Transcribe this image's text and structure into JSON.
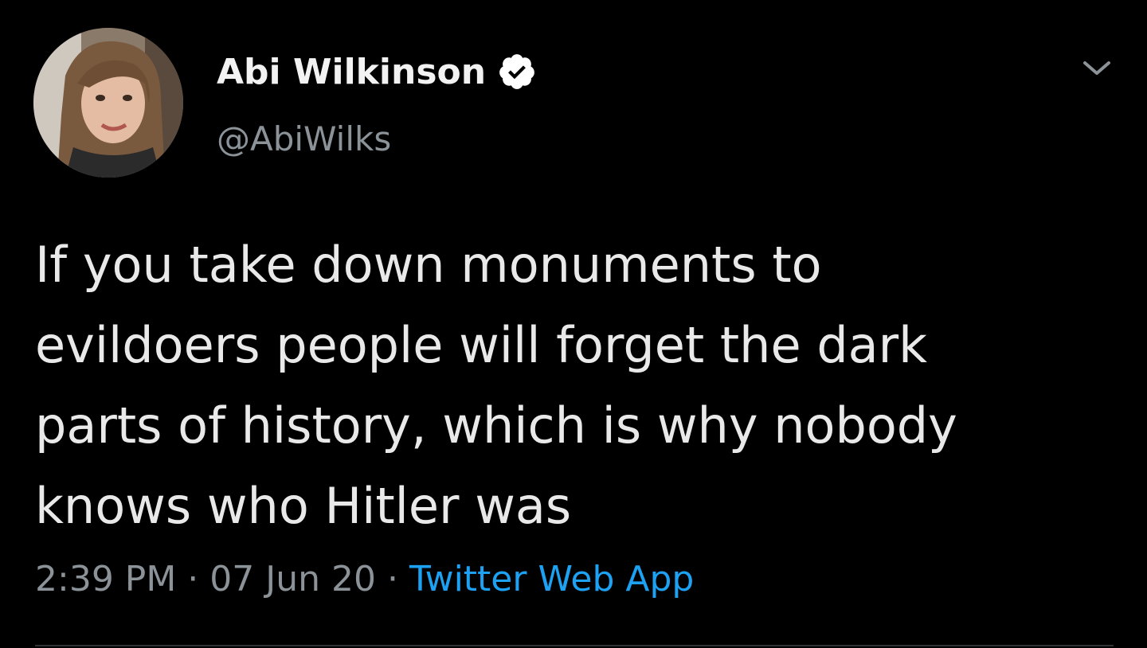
{
  "colors": {
    "background": "#000000",
    "text": "#e9e9e9",
    "secondary_text": "#8b9298",
    "link": "#1da1f2",
    "verified_badge": "#ffffff"
  },
  "author": {
    "display_name": "Abi Wilkinson",
    "handle": "@AbiWilks",
    "verified": true,
    "avatar_icon": "profile-photo"
  },
  "tweet": {
    "text": "If you take down monuments to\nevildoers people will forget the dark\nparts of history, which is why nobody\nknows who Hitler was",
    "time": "2:39 PM",
    "separator": "·",
    "date": "07 Jun 20",
    "source": "Twitter Web App"
  },
  "icons": {
    "verified": "verified-badge-icon",
    "menu": "chevron-down-icon"
  }
}
